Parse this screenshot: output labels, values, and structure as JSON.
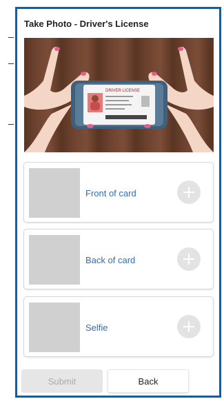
{
  "header": {
    "title": "Take Photo - Driver's License"
  },
  "hero": {
    "id_card_title": "DRIVER LICENSE",
    "colors": {
      "wood": "#6e4330",
      "phone": "#5b7c99",
      "skin": "#f4d6c6",
      "nails": "#e05f8c"
    }
  },
  "cards": [
    {
      "label": "Front of card"
    },
    {
      "label": "Back of card"
    },
    {
      "label": "Selfie"
    }
  ],
  "buttons": {
    "submit_label": "Submit",
    "back_label": "Back"
  },
  "colors": {
    "frame_border": "#1f5b8c",
    "label_blue": "#2f6fb3"
  }
}
